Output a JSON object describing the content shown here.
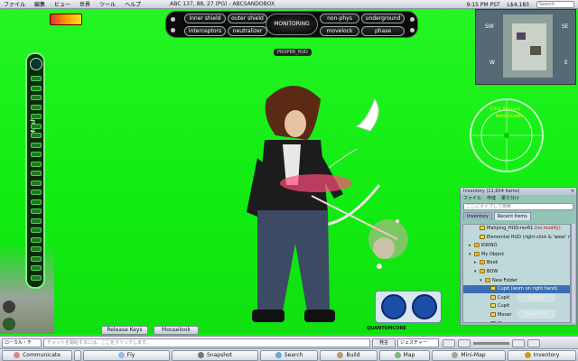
{
  "menubar": {
    "items": [
      "ファイル",
      "編集",
      "ビュー",
      "世界",
      "ツール",
      "ヘルプ"
    ],
    "location": "ABC 137, 88, 27 (PG) - ABCSANDOBOX",
    "time": "9:15 PM PST",
    "balance": "L$4,183",
    "search_placeholder": "Search"
  },
  "hud": {
    "buttons": {
      "inner_shield": "inner shield",
      "outer_shield": "outer shield",
      "monitoring": "MONITORING",
      "non_phys": "non-phys",
      "underground": "underground",
      "interceptors": "interceptors",
      "neutralizer": "neutralizer",
      "movelock": "movelock",
      "phase": "phase"
    }
  },
  "leftbar": {
    "title": "Mesh"
  },
  "nametag": "PROPER_HUD",
  "radar": {
    "labels": [
      "Click Raycast",
      "Aero Guides"
    ]
  },
  "inventory": {
    "title": "Inventory (11,604 items)",
    "menu": [
      "ファイル",
      "作成",
      "振り分け"
    ],
    "filter_placeholder": "ここにタイプして検索",
    "tabs": [
      "Inventory",
      "Recent Items"
    ],
    "rows": [
      {
        "label": "Mahjong_HUD-rev61",
        "note": "(no modify)",
        "type": "obj",
        "depth": 2
      },
      {
        "label": "Elemental HUD (right-click & 'wear' me",
        "note": "",
        "type": "obj",
        "depth": 2
      },
      {
        "label": "KIRINO",
        "note": "",
        "type": "fold",
        "depth": 1
      },
      {
        "label": "My Object",
        "note": "",
        "type": "fold",
        "depth": 1,
        "open": true
      },
      {
        "label": "Book",
        "note": "",
        "type": "fold",
        "depth": 2
      },
      {
        "label": "BOW",
        "note": "",
        "type": "fold",
        "depth": 2,
        "open": true
      },
      {
        "label": "New Folder",
        "note": "",
        "type": "fold",
        "depth": 3,
        "open": true
      },
      {
        "label": "Cupit",
        "note": "(worn on right hand)",
        "type": "obj",
        "depth": 4,
        "selected": true
      },
      {
        "label": "Cupit",
        "note": "",
        "type": "obj",
        "depth": 4
      },
      {
        "label": "Cupit",
        "note": "",
        "type": "obj",
        "depth": 4
      },
      {
        "label": "Mover",
        "note": "",
        "type": "obj",
        "depth": 4
      },
      {
        "label": "Mover",
        "note": "",
        "type": "obj",
        "depth": 4
      }
    ],
    "ghost_buttons": [
      "Volume",
      "Toggle TP"
    ]
  },
  "scene_buttons": {
    "release_keys": "Release Keys",
    "mouselook": "Mouselook"
  },
  "quantum_logo": "QUANTUMCORE",
  "chatbar": {
    "channel": "ローカル・チ",
    "placeholder": "チャットを開始するには、ここをクリックします。",
    "say": "発言",
    "gesture": "ジェスチャー"
  },
  "toolbar": {
    "communicate": "Communicate",
    "fly": "Fly",
    "snapshot": "Snapshot",
    "search": "Search",
    "build": "Build",
    "map": "Map",
    "minimap": "Mini-Map",
    "inventory": "Inventory"
  },
  "colors": {
    "screen": "#14ef14",
    "hud_bg": "#0b0b0b",
    "selection": "#3a6fb3",
    "leftbar_seg": "#1d7a1d"
  }
}
